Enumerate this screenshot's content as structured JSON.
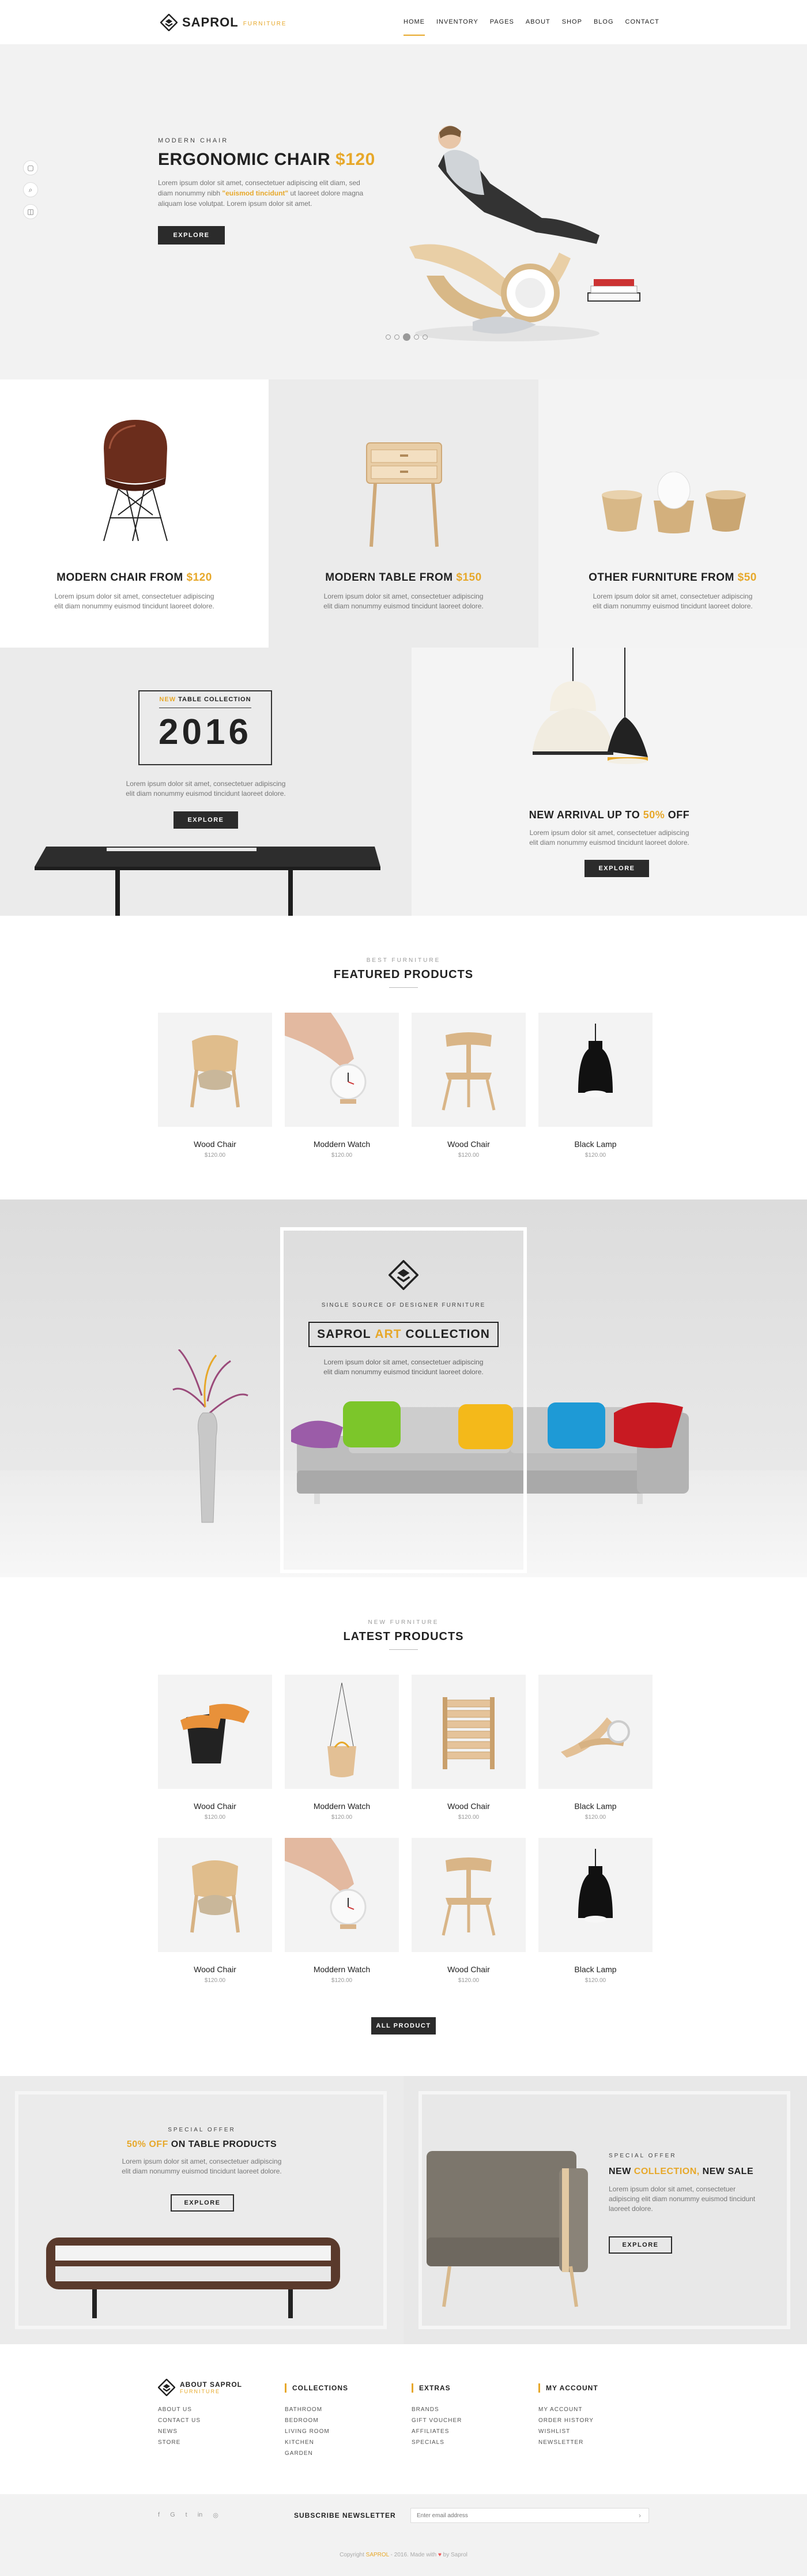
{
  "brand": {
    "name": "SAPROL",
    "tag": "FURNITURE"
  },
  "nav": [
    "HOME",
    "INVENTORY",
    "PAGES",
    "ABOUT",
    "SHOP",
    "BLOG",
    "CONTACT"
  ],
  "hero": {
    "kicker": "MODERN CHAIR",
    "title": "ERGONOMIC CHAIR",
    "price": "$120",
    "desc_a": "Lorem ipsum dolor sit amet, consectetuer adipiscing elit diam, sed diam nonummy nibh",
    "desc_em": "\"euismod tincidunt\"",
    "desc_b": "ut laoreet dolore magna aliquam lose volutpat.  Lorem ipsum dolor sit amet.",
    "button": "EXPLORE",
    "slides": 5,
    "active_slide": 3
  },
  "categories": [
    {
      "title": "MODERN CHAIR FROM",
      "price": "$120",
      "desc": "Lorem ipsum dolor sit amet, consectetuer adipiscing elit diam nonummy euismod tincidunt laoreet dolore."
    },
    {
      "title": "MODERN TABLE FROM",
      "price": "$150",
      "desc": "Lorem ipsum dolor sit amet, consectetuer adipiscing elit diam nonummy euismod tincidunt laoreet dolore."
    },
    {
      "title": "OTHER FURNITURE FROM",
      "price": "$50",
      "desc": "Lorem ipsum dolor sit amet, consectetuer adipiscing elit diam nonummy euismod tincidunt laoreet dolore."
    }
  ],
  "collection": {
    "new": "NEW",
    "label": "TABLE COLLECTION",
    "year": "2016",
    "desc": "Lorem ipsum dolor sit amet, consectetuer adipiscing elit diam nonummy euismod tincidunt laoreet dolore.",
    "button": "EXPLORE"
  },
  "arrival": {
    "title": "NEW ARRIVAL UP TO",
    "pct": "50%",
    "off": "OFF",
    "desc": "Lorem ipsum dolor sit amet, consectetuer adipiscing elit diam nonummy euismod tincidunt laoreet dolore.",
    "button": "EXPLORE"
  },
  "featured": {
    "kicker": "BEST FURNITURE",
    "title": "FEATURED PRODUCTS",
    "items": [
      {
        "name": "Wood Chair",
        "price": "$120.00"
      },
      {
        "name": "Moddern Watch",
        "price": "$120.00"
      },
      {
        "name": "Wood Chair",
        "price": "$120.00"
      },
      {
        "name": "Black Lamp",
        "price": "$120.00"
      }
    ]
  },
  "art": {
    "kicker": "SINGLE SOURCE OF DESIGNER FURNITURE",
    "title_a": "SAPROL",
    "title_b": "ART",
    "title_c": "COLLECTION",
    "desc": "Lorem ipsum dolor sit amet, consectetuer adipiscing elit diam nonummy euismod tincidunt laoreet dolore."
  },
  "latest": {
    "kicker": "NEW FURNITURE",
    "title": "LATEST PRODUCTS",
    "items": [
      {
        "name": "Wood Chair",
        "price": "$120.00"
      },
      {
        "name": "Moddern Watch",
        "price": "$120.00"
      },
      {
        "name": "Wood Chair",
        "price": "$120.00"
      },
      {
        "name": "Black Lamp",
        "price": "$120.00"
      },
      {
        "name": "Wood Chair",
        "price": "$120.00"
      },
      {
        "name": "Moddern Watch",
        "price": "$120.00"
      },
      {
        "name": "Wood Chair",
        "price": "$120.00"
      },
      {
        "name": "Black Lamp",
        "price": "$120.00"
      }
    ],
    "button": "ALL PRODUCT"
  },
  "offer": {
    "kicker": "SPECIAL OFFER",
    "pct": "50% OFF",
    "rest": "ON TABLE PRODUCTS",
    "desc": "Lorem ipsum dolor sit amet, consectetuer adipiscing elit diam nonummy euismod tincidunt laoreet dolore.",
    "button": "EXPLORE"
  },
  "sale": {
    "kicker": "SPECIAL OFFER",
    "new": "NEW",
    "collection": "COLLECTION,",
    "rest": "NEW SALE",
    "desc": "Lorem ipsum dolor sit amet, consectetuer adipiscing elit diam nonummy euismod tincidunt laoreet dolore.",
    "button": "EXPLORE"
  },
  "footer": {
    "about": {
      "title": "ABOUT SAPROL",
      "tag": "FURNITURE",
      "links": [
        "ABOUT US",
        "CONTACT US",
        "NEWS",
        "STORE"
      ]
    },
    "collections": {
      "title": "COLLECTIONS",
      "links": [
        "BATHROOM",
        "BEDROOM",
        "LIVING ROOM",
        "KITCHEN",
        "GARDEN"
      ]
    },
    "extras": {
      "title": "EXTRAS",
      "links": [
        "BRANDS",
        "GIFT VOUCHER",
        "AFFILIATES",
        "SPECIALS"
      ]
    },
    "account": {
      "title": "MY ACCOUNT",
      "links": [
        "MY ACCOUNT",
        "ORDER HISTORY",
        "WISHLIST",
        "NEWSLETTER"
      ]
    }
  },
  "newsletter": {
    "label": "SUBSCRIBE NEWSLETTER",
    "placeholder": "Enter email address"
  },
  "social": [
    "f",
    "G",
    "t",
    "in",
    "◎"
  ],
  "copyright": {
    "a": "Copyright",
    "brand": "SAPROL",
    "b": "- 2016. Made with",
    "c": "by Saprol"
  },
  "colors": {
    "accent": "#e7a82a",
    "dark": "#2b2b2b",
    "light": "#f2f2f2"
  }
}
